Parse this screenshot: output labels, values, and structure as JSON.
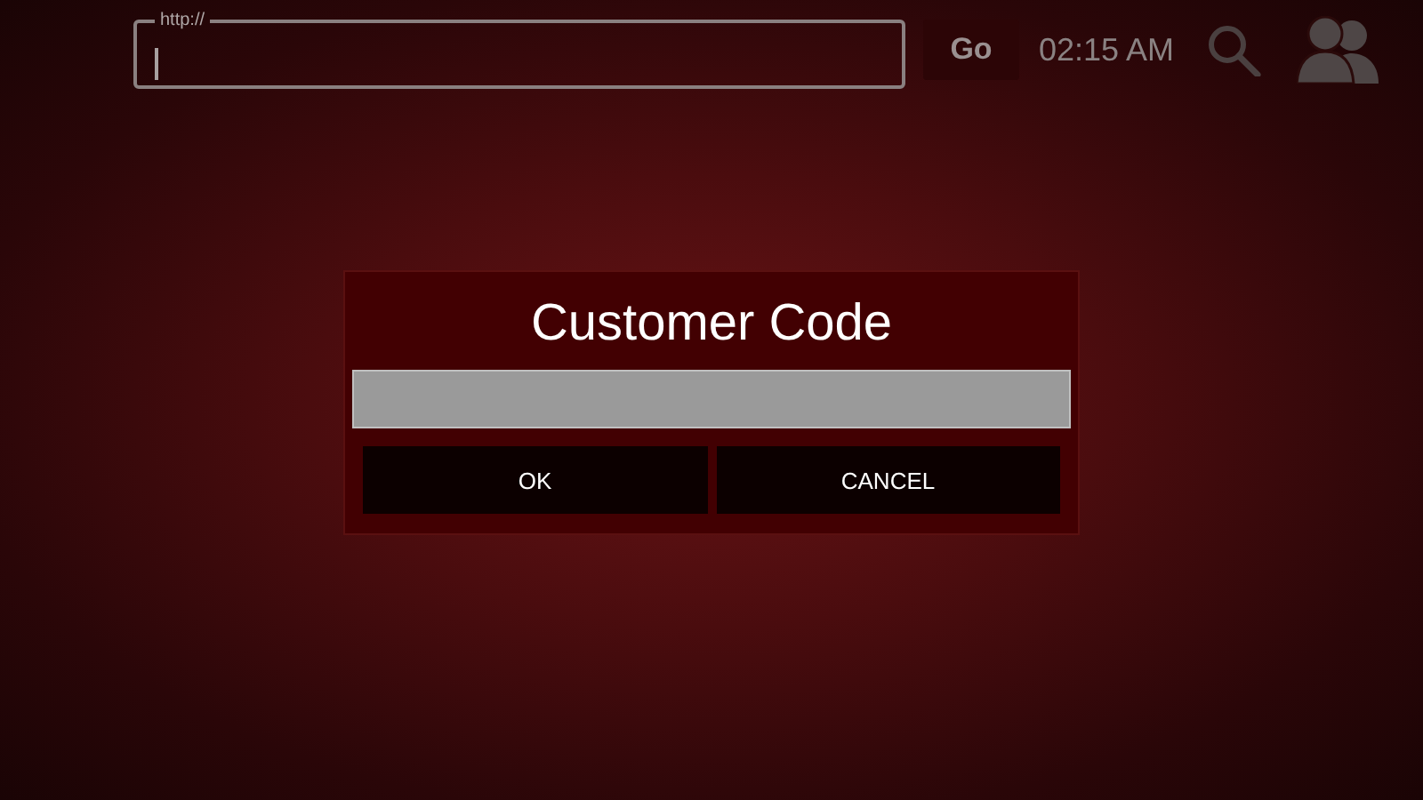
{
  "top_bar": {
    "url_field": {
      "label": "http://"
    },
    "go_button": "Go",
    "time": "02:15 AM"
  },
  "dialog": {
    "title": "Customer Code",
    "buttons": [
      "OK",
      "CANCEL"
    ]
  }
}
